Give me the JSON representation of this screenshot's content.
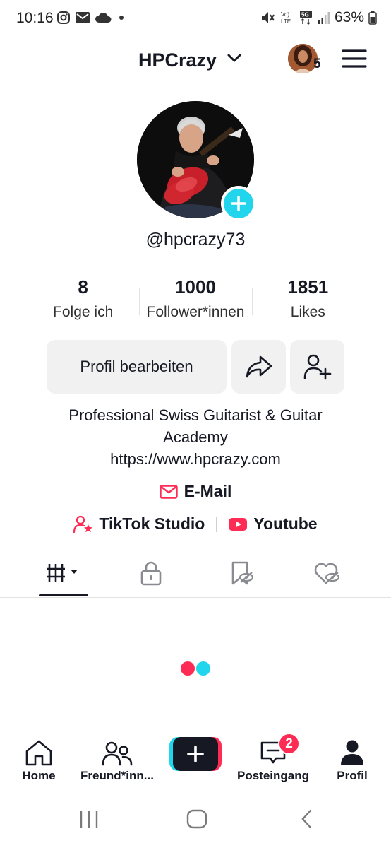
{
  "status_bar": {
    "time": "10:16",
    "battery": "63%"
  },
  "header": {
    "username": "HPCrazy",
    "notification_count": "5"
  },
  "profile": {
    "handle": "@hpcrazy73",
    "stats": [
      {
        "value": "8",
        "label": "Folge ich"
      },
      {
        "value": "1000",
        "label": "Follower*innen"
      },
      {
        "value": "1851",
        "label": "Likes"
      }
    ],
    "edit_button": "Profil bearbeiten",
    "bio_line1": "Professional Swiss Guitarist & Guitar",
    "bio_line2": "Academy",
    "website": "https://www.hpcrazy.com",
    "email_label": "E-Mail",
    "studio_label": "TikTok Studio",
    "youtube_label": "Youtube"
  },
  "tabs": [
    {
      "icon": "videos-grid-icon",
      "active": true
    },
    {
      "icon": "lock-icon",
      "active": false
    },
    {
      "icon": "saved-hidden-icon",
      "active": false
    },
    {
      "icon": "liked-hidden-icon",
      "active": false
    }
  ],
  "bottom_nav": {
    "home": "Home",
    "friends": "Freund*inn...",
    "inbox": "Posteingang",
    "inbox_badge": "2",
    "profile": "Profil"
  },
  "colors": {
    "accent_cyan": "#20d5ec",
    "accent_red": "#fe2c55",
    "text_dark": "#161823",
    "button_bg": "#f1f1f2"
  }
}
